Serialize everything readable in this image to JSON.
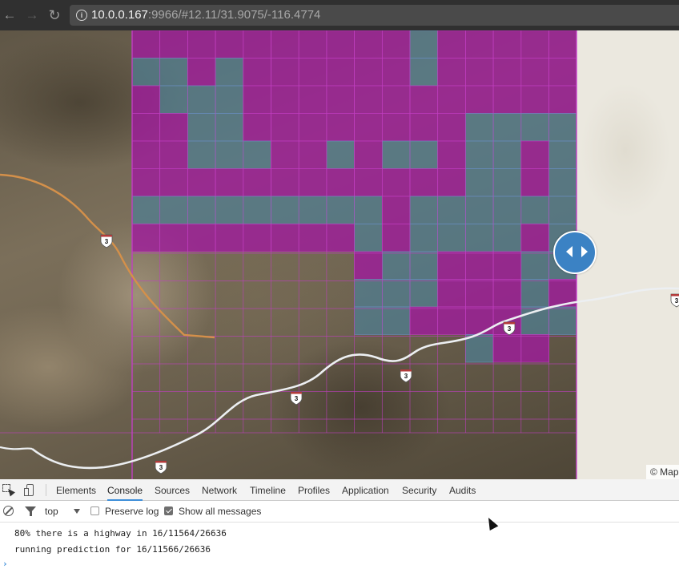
{
  "browser": {
    "url_host": "10.0.0.167",
    "url_rest": ":9966/#12.11/31.9075/-116.4774",
    "icons": [
      "back-arrow-icon",
      "forward-arrow-icon",
      "reload-icon",
      "info-icon"
    ]
  },
  "map": {
    "highway_shield_label": "3",
    "attribution": "© Mapbox",
    "tile_overlay_colors": {
      "highway_unlikely": "#a0199e",
      "highway_likely": "#4f7e93",
      "grid_line": "#c040c0"
    },
    "swipe_control_icon": "left-right-arrows-icon"
  },
  "devtools": {
    "tabs": [
      "Elements",
      "Console",
      "Sources",
      "Network",
      "Timeline",
      "Profiles",
      "Application",
      "Security",
      "Audits"
    ],
    "active_tab": "Console",
    "context": "top",
    "preserve_log_label": "Preserve log",
    "preserve_log_checked": false,
    "show_all_label": "Show all messages",
    "show_all_checked": true,
    "log": [
      "80% there is a highway in 16/11564/26636",
      "running prediction for 16/11566/26636"
    ]
  }
}
